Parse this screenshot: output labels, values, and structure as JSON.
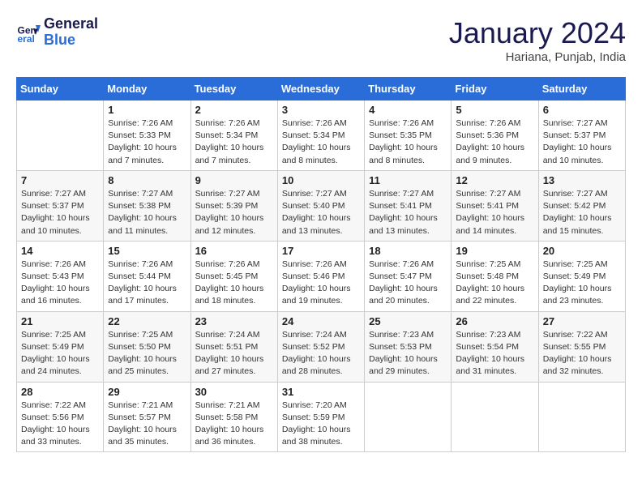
{
  "header": {
    "logo_line1": "General",
    "logo_line2": "Blue",
    "month": "January 2024",
    "location": "Hariana, Punjab, India"
  },
  "weekdays": [
    "Sunday",
    "Monday",
    "Tuesday",
    "Wednesday",
    "Thursday",
    "Friday",
    "Saturday"
  ],
  "weeks": [
    [
      {
        "day": "",
        "info": ""
      },
      {
        "day": "1",
        "info": "Sunrise: 7:26 AM\nSunset: 5:33 PM\nDaylight: 10 hours\nand 7 minutes."
      },
      {
        "day": "2",
        "info": "Sunrise: 7:26 AM\nSunset: 5:34 PM\nDaylight: 10 hours\nand 7 minutes."
      },
      {
        "day": "3",
        "info": "Sunrise: 7:26 AM\nSunset: 5:34 PM\nDaylight: 10 hours\nand 8 minutes."
      },
      {
        "day": "4",
        "info": "Sunrise: 7:26 AM\nSunset: 5:35 PM\nDaylight: 10 hours\nand 8 minutes."
      },
      {
        "day": "5",
        "info": "Sunrise: 7:26 AM\nSunset: 5:36 PM\nDaylight: 10 hours\nand 9 minutes."
      },
      {
        "day": "6",
        "info": "Sunrise: 7:27 AM\nSunset: 5:37 PM\nDaylight: 10 hours\nand 10 minutes."
      }
    ],
    [
      {
        "day": "7",
        "info": "Sunrise: 7:27 AM\nSunset: 5:37 PM\nDaylight: 10 hours\nand 10 minutes."
      },
      {
        "day": "8",
        "info": "Sunrise: 7:27 AM\nSunset: 5:38 PM\nDaylight: 10 hours\nand 11 minutes."
      },
      {
        "day": "9",
        "info": "Sunrise: 7:27 AM\nSunset: 5:39 PM\nDaylight: 10 hours\nand 12 minutes."
      },
      {
        "day": "10",
        "info": "Sunrise: 7:27 AM\nSunset: 5:40 PM\nDaylight: 10 hours\nand 13 minutes."
      },
      {
        "day": "11",
        "info": "Sunrise: 7:27 AM\nSunset: 5:41 PM\nDaylight: 10 hours\nand 13 minutes."
      },
      {
        "day": "12",
        "info": "Sunrise: 7:27 AM\nSunset: 5:41 PM\nDaylight: 10 hours\nand 14 minutes."
      },
      {
        "day": "13",
        "info": "Sunrise: 7:27 AM\nSunset: 5:42 PM\nDaylight: 10 hours\nand 15 minutes."
      }
    ],
    [
      {
        "day": "14",
        "info": "Sunrise: 7:26 AM\nSunset: 5:43 PM\nDaylight: 10 hours\nand 16 minutes."
      },
      {
        "day": "15",
        "info": "Sunrise: 7:26 AM\nSunset: 5:44 PM\nDaylight: 10 hours\nand 17 minutes."
      },
      {
        "day": "16",
        "info": "Sunrise: 7:26 AM\nSunset: 5:45 PM\nDaylight: 10 hours\nand 18 minutes."
      },
      {
        "day": "17",
        "info": "Sunrise: 7:26 AM\nSunset: 5:46 PM\nDaylight: 10 hours\nand 19 minutes."
      },
      {
        "day": "18",
        "info": "Sunrise: 7:26 AM\nSunset: 5:47 PM\nDaylight: 10 hours\nand 20 minutes."
      },
      {
        "day": "19",
        "info": "Sunrise: 7:25 AM\nSunset: 5:48 PM\nDaylight: 10 hours\nand 22 minutes."
      },
      {
        "day": "20",
        "info": "Sunrise: 7:25 AM\nSunset: 5:49 PM\nDaylight: 10 hours\nand 23 minutes."
      }
    ],
    [
      {
        "day": "21",
        "info": "Sunrise: 7:25 AM\nSunset: 5:49 PM\nDaylight: 10 hours\nand 24 minutes."
      },
      {
        "day": "22",
        "info": "Sunrise: 7:25 AM\nSunset: 5:50 PM\nDaylight: 10 hours\nand 25 minutes."
      },
      {
        "day": "23",
        "info": "Sunrise: 7:24 AM\nSunset: 5:51 PM\nDaylight: 10 hours\nand 27 minutes."
      },
      {
        "day": "24",
        "info": "Sunrise: 7:24 AM\nSunset: 5:52 PM\nDaylight: 10 hours\nand 28 minutes."
      },
      {
        "day": "25",
        "info": "Sunrise: 7:23 AM\nSunset: 5:53 PM\nDaylight: 10 hours\nand 29 minutes."
      },
      {
        "day": "26",
        "info": "Sunrise: 7:23 AM\nSunset: 5:54 PM\nDaylight: 10 hours\nand 31 minutes."
      },
      {
        "day": "27",
        "info": "Sunrise: 7:22 AM\nSunset: 5:55 PM\nDaylight: 10 hours\nand 32 minutes."
      }
    ],
    [
      {
        "day": "28",
        "info": "Sunrise: 7:22 AM\nSunset: 5:56 PM\nDaylight: 10 hours\nand 33 minutes."
      },
      {
        "day": "29",
        "info": "Sunrise: 7:21 AM\nSunset: 5:57 PM\nDaylight: 10 hours\nand 35 minutes."
      },
      {
        "day": "30",
        "info": "Sunrise: 7:21 AM\nSunset: 5:58 PM\nDaylight: 10 hours\nand 36 minutes."
      },
      {
        "day": "31",
        "info": "Sunrise: 7:20 AM\nSunset: 5:59 PM\nDaylight: 10 hours\nand 38 minutes."
      },
      {
        "day": "",
        "info": ""
      },
      {
        "day": "",
        "info": ""
      },
      {
        "day": "",
        "info": ""
      }
    ]
  ]
}
